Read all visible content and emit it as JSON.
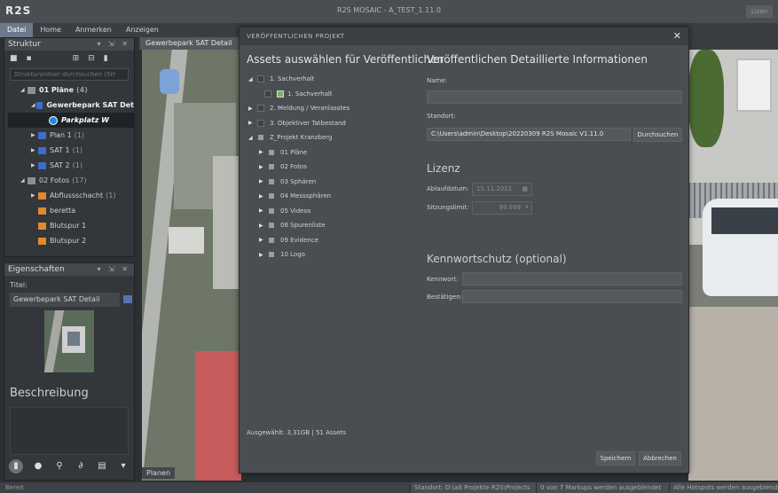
{
  "app": {
    "logo": "R2S",
    "window_title": "R2S MOSAIC - A_TEST_1.11.0",
    "login_label": "Lizen"
  },
  "menu": [
    "Datei",
    "Home",
    "Anmerken",
    "Anzeigen"
  ],
  "struktur": {
    "title": "Struktur",
    "search_placeholder": "Strukturordner durchsuchen (Str",
    "tree": [
      {
        "label": "01 Pläne",
        "count": "(4)"
      },
      {
        "label": "Gewerbepark SAT Det"
      },
      {
        "label": "Parkplatz W"
      },
      {
        "label": "Plan 1",
        "count": "(1)"
      },
      {
        "label": "SAT 1",
        "count": "(1)"
      },
      {
        "label": "SAT 2",
        "count": "(1)"
      },
      {
        "label": "02 Fotos",
        "count": "(17)"
      },
      {
        "label": "Abflussschacht",
        "count": "(1)"
      },
      {
        "label": "beretta"
      },
      {
        "label": "Blutspur 1"
      },
      {
        "label": "Blutspur 2"
      }
    ]
  },
  "eigenschaften": {
    "title": "Eigenschaften",
    "titel_label": "Titel:",
    "titel_value": "Gewerbepark SAT Detail",
    "beschreibung_label": "Beschreibung"
  },
  "doc_tab": {
    "label": "Gewerbepark SAT Detail",
    "close": "✕"
  },
  "bottom_tab": "Planen",
  "statusbar": {
    "left": "Bereit",
    "segments": [
      "Standort: D:\\alt Projekte R2S\\Projects",
      "0 von 7 Markups werden ausgeblendet",
      "Alle Hotspots werden ausgeblendet"
    ]
  },
  "dialog": {
    "title": "VERÖFFENTLICHEN PROJEKT",
    "left_heading": "Assets auswählen für Veröffentlichen",
    "right_heading": "Veröffentlichen Detaillierte Informationen",
    "tree": [
      {
        "label": "1. Sachverhalt",
        "level": 0,
        "expanded": true,
        "check": "none"
      },
      {
        "label": "1. Sachverhalt",
        "level": 1,
        "leaf": true,
        "check": "none"
      },
      {
        "label": "2. Meldung / Veranlasstes",
        "level": 0,
        "expanded": false,
        "check": "none"
      },
      {
        "label": "3. Objektiver Tatbestand",
        "level": 0,
        "expanded": false,
        "check": "none"
      },
      {
        "label": "Z_Projekt Kranzberg",
        "level": 0,
        "expanded": true,
        "check": "partial"
      },
      {
        "label": "01 Pläne",
        "level": 1,
        "expanded": false,
        "check": "partial"
      },
      {
        "label": "02 Fotos",
        "level": 1,
        "expanded": false,
        "check": "partial"
      },
      {
        "label": "03 Sphären",
        "level": 1,
        "expanded": false,
        "check": "partial"
      },
      {
        "label": "04 Messsphären",
        "level": 1,
        "expanded": false,
        "check": "partial"
      },
      {
        "label": "05 Videos",
        "level": 1,
        "expanded": false,
        "check": "partial"
      },
      {
        "label": "08 Spurenliste",
        "level": 1,
        "expanded": false,
        "check": "partial"
      },
      {
        "label": "09 Evidence",
        "level": 1,
        "expanded": false,
        "check": "partial"
      },
      {
        "label": "10 Logo",
        "level": 1,
        "expanded": false,
        "check": "partial"
      }
    ],
    "selected_status": "Ausgewählt: 3,31GB | 51 Assets",
    "name_label": "Name:",
    "name_value": "",
    "standort_label": "Standort:",
    "standort_value": "C:\\Users\\admin\\Desktop\\20220309 R2S Mosaic V1.11.0",
    "durchsuchen": "Durchsuchen",
    "lizenz_heading": "Lizenz",
    "ablauf_label": "Ablaufdatum:",
    "ablauf_value": "15.11.2022",
    "sitzung_label": "Sitzungslimit:",
    "sitzung_value": "99.999",
    "kennwort_heading": "Kennwortschutz (optional)",
    "kennwort_label": "Kennwort:",
    "bestaetigen_label": "Bestätigen:",
    "speichern": "Speichern",
    "abbrechen": "Abbrechen",
    "close": "✕"
  }
}
